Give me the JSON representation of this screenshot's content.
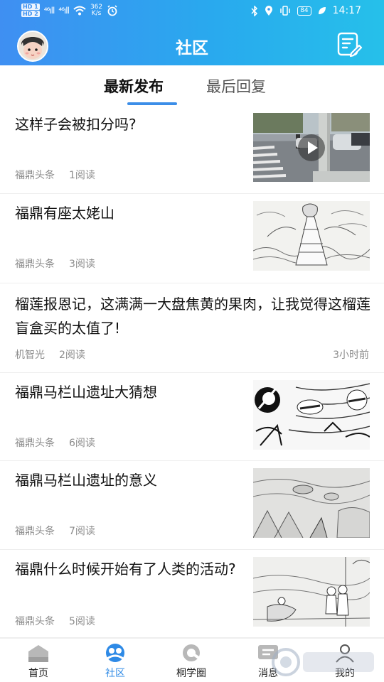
{
  "status_bar": {
    "sim1": "HD 1",
    "sim2": "HD 2",
    "signal1": "⁴⁶ıll",
    "signal2": "⁴⁶ıll",
    "speed_value": "362",
    "speed_unit": "K/s",
    "time": "14:17",
    "battery": "84"
  },
  "header": {
    "title": "社区"
  },
  "tabs": [
    {
      "label": "最新发布",
      "active": true
    },
    {
      "label": "最后回复",
      "active": false
    }
  ],
  "feed": [
    {
      "title": "这样子会被扣分吗?",
      "source": "福鼎头条",
      "reads": "1阅读",
      "has_video": true
    },
    {
      "title": "福鼎有座太姥山",
      "source": "福鼎头条",
      "reads": "3阅读"
    },
    {
      "title": "榴莲报恩记，这满满一大盘焦黄的果肉，让我觉得这榴莲盲盒买的太值了!",
      "source": "机智光",
      "reads": "2阅读",
      "time_ago": "3小时前"
    },
    {
      "title": "福鼎马栏山遗址大猜想",
      "source": "福鼎头条",
      "reads": "6阅读"
    },
    {
      "title": "福鼎马栏山遗址的意义",
      "source": "福鼎头条",
      "reads": "7阅读"
    },
    {
      "title": "福鼎什么时候开始有了人类的活动?",
      "source": "福鼎头条",
      "reads": "5阅读"
    }
  ],
  "tabbar": [
    {
      "label": "首页",
      "icon": "home-icon"
    },
    {
      "label": "社区",
      "icon": "community-icon",
      "active": true
    },
    {
      "label": "桐学圈",
      "icon": "circle-icon"
    },
    {
      "label": "消息",
      "icon": "message-icon"
    },
    {
      "label": "我的",
      "icon": "profile-icon"
    }
  ],
  "colors": {
    "accent": "#2e8ae6",
    "header_start": "#3f8ff2",
    "header_end": "#26c0ea"
  }
}
